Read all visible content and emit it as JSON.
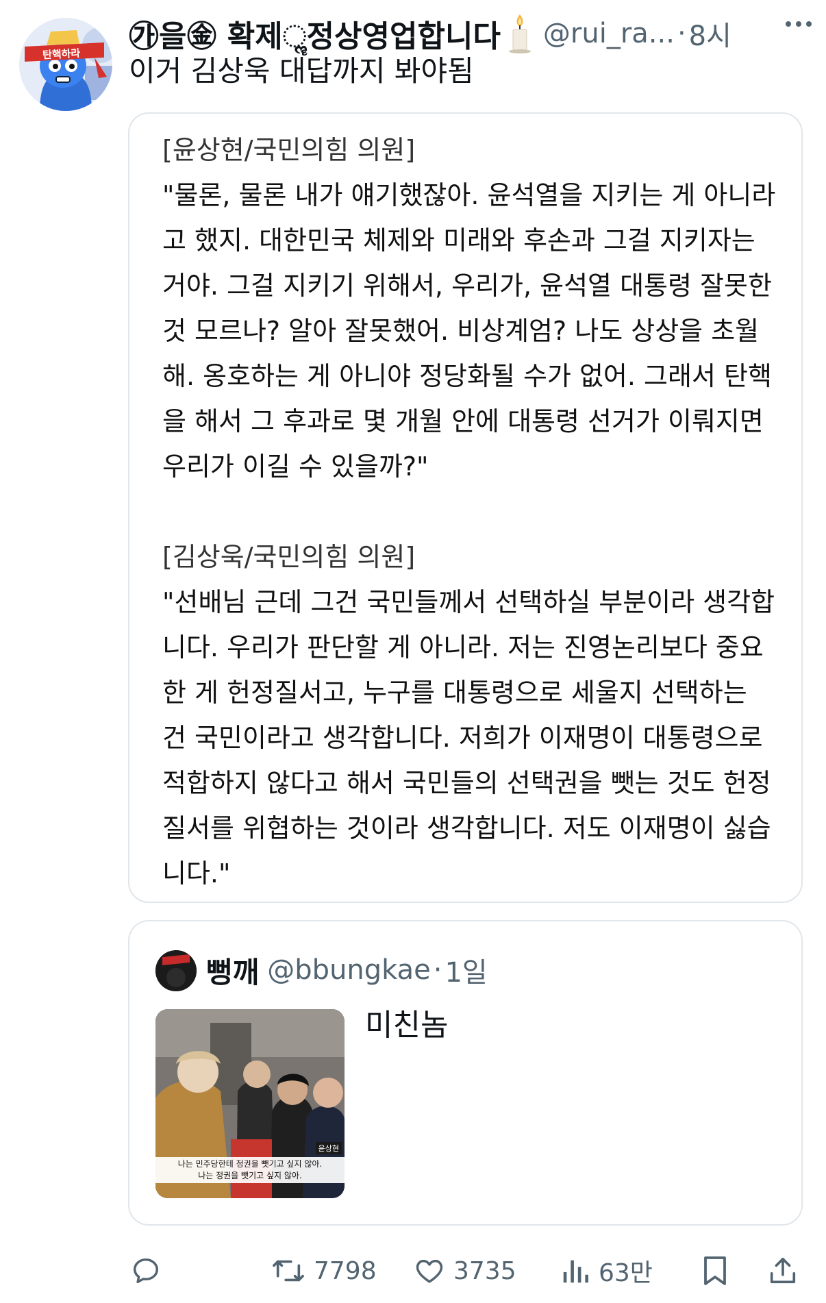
{
  "author": {
    "display_name": "㉮을㊎ 확제ૣ정상영업합니다",
    "handle": "@rui_ra...",
    "separator": "·",
    "time": "8시",
    "avatar_banner_text": "탄핵하라"
  },
  "tweet": {
    "text": "이거 김상욱 대답까지 봐야됨"
  },
  "card": {
    "speaker1": "[윤상현/국민의힘 의원]",
    "quote1": "\"물론, 물론 내가 얘기했잖아. 윤석열을 지키는 게 아니라 고 했지. 대한민국 체제와 미래와 후손과 그걸 지키자는 거야. 그걸 지키기 위해서, 우리가, 윤석열 대통령 잘못한 것 모르나? 알아 잘못했어. 비상계엄? 나도 상상을 초월해. 옹호하는 게 아니야 정당화될 수가 없어. 그래서 탄핵을 해서 그 후과로 몇 개월 안에 대통령 선거가 이뤄지면 우리가 이길 수 있을까?\"",
    "speaker2": "[김상욱/국민의힘 의원]",
    "quote2": "\"선배님 근데 그건 국민들께서 선택하실 부분이라 생각합니다. 우리가 판단할 게 아니라. 저는 진영논리보다 중요한 게 헌정질서고, 누구를 대통령으로 세울지 선택하는 건 국민이라고 생각합니다. 저희가 이재명이 대통령으로 적합하지 않다고 해서 국민들의 선택권을 뺏는 것도 헌정질서를 위협하는 것이라 생각합니다. 저도 이재명이 싫습니다.\""
  },
  "quoted_tweet": {
    "display_name": "뻥깨",
    "handle": "@bbungkae",
    "separator": "·",
    "time": "1일",
    "text": "미친놈",
    "thumbnail_caption_line1": "나는 민주당한테 정권을 뺏기고 싶지 않아.",
    "thumbnail_caption_line2": "나는 정권을 뺏기고 싶지 않아.",
    "thumbnail_label": "윤상현"
  },
  "actions": {
    "reply_icon": "reply-icon",
    "retweet_icon": "retweet-icon",
    "retweet_count": "7798",
    "like_icon": "heart-icon",
    "like_count": "3735",
    "views_icon": "views-icon",
    "views_count": "63만",
    "bookmark_icon": "bookmark-icon",
    "share_icon": "share-icon"
  },
  "colors": {
    "text_primary": "#0f1419",
    "text_secondary": "#536471",
    "border": "#e1e6ea",
    "avatar_banner": "#d6312b"
  }
}
